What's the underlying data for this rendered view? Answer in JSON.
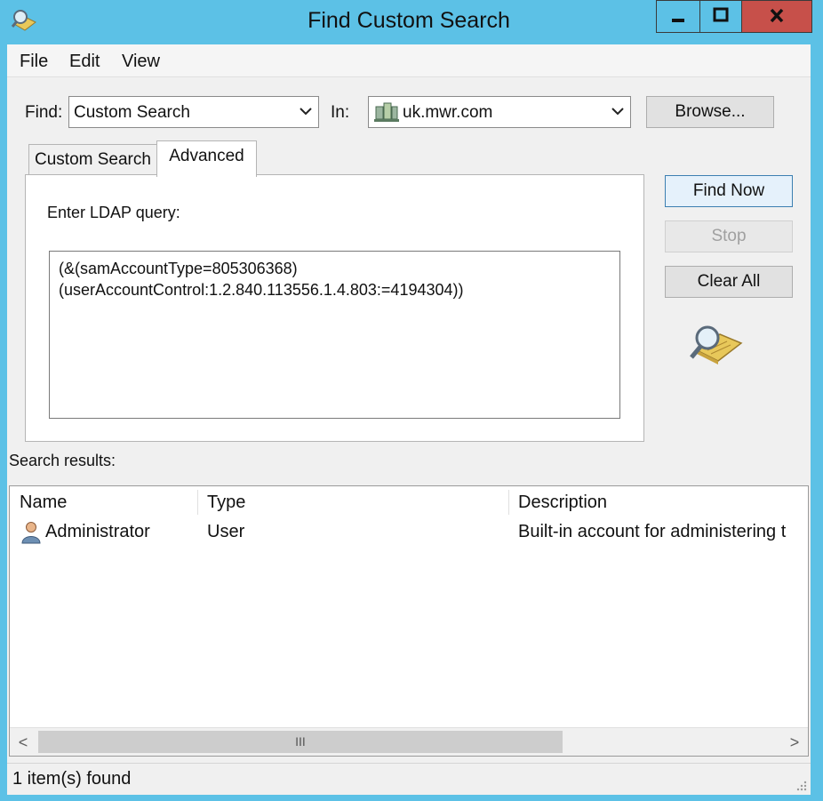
{
  "window": {
    "title": "Find Custom Search",
    "colors": {
      "frame": "#5cc1e6",
      "close_button": "#c7504a",
      "client": "#f0f0f0"
    }
  },
  "titlebar_icons": {
    "app": "find-search-icon",
    "min": "minimize-icon",
    "max": "maximize-icon",
    "close": "close-icon"
  },
  "menu": {
    "file": "File",
    "edit": "Edit",
    "view": "View"
  },
  "find": {
    "label": "Find:",
    "value": "Custom Search"
  },
  "in": {
    "label": "In:",
    "value": "uk.mwr.com",
    "icon": "domain-icon"
  },
  "buttons": {
    "browse": "Browse...",
    "find_now": "Find Now",
    "stop": "Stop",
    "clear_all": "Clear All"
  },
  "tabs": [
    {
      "label": "Custom Search",
      "active": false
    },
    {
      "label": "Advanced",
      "active": true
    }
  ],
  "advanced": {
    "prompt": "Enter LDAP query:",
    "query_lines": [
      "(&(samAccountType=805306368)",
      "(userAccountControl:1.2.840.113556.1.4.803:=4194304))"
    ]
  },
  "results": {
    "label": "Search results:",
    "columns": [
      "Name",
      "Type",
      "Description"
    ],
    "rows": [
      {
        "name": "Administrator",
        "type": "User",
        "description": "Built-in account for administering t",
        "icon": "user-icon"
      }
    ]
  },
  "scrollbar": {
    "left": "<",
    "right": ">",
    "thumb_grip": "III"
  },
  "status": {
    "text": "1 item(s) found"
  }
}
